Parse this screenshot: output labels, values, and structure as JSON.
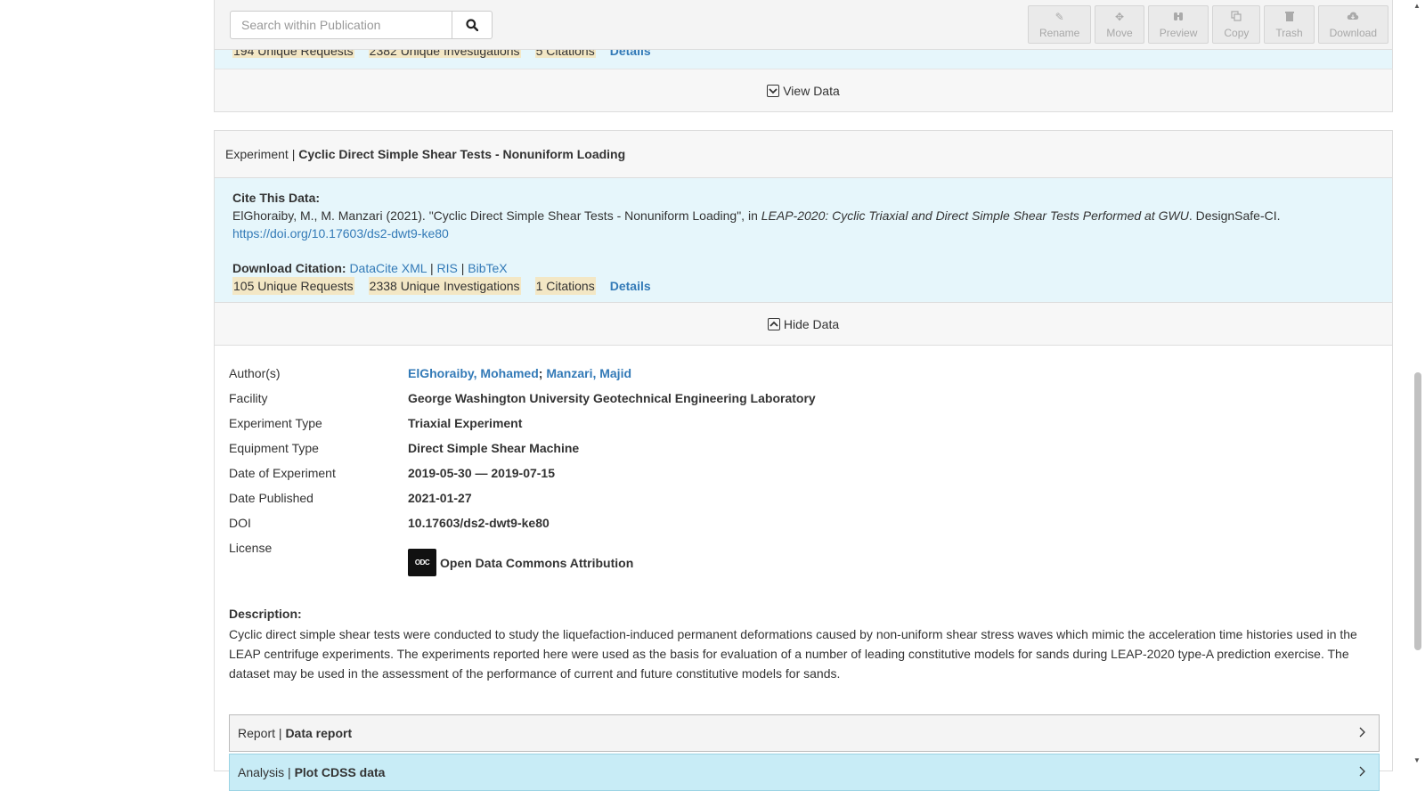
{
  "toolbar": {
    "search_placeholder": "Search within Publication",
    "buttons": [
      {
        "label": "Rename",
        "icon": "pencil-icon"
      },
      {
        "label": "Move",
        "icon": "move-icon"
      },
      {
        "label": "Preview",
        "icon": "binoculars-icon"
      },
      {
        "label": "Copy",
        "icon": "copy-icon"
      },
      {
        "label": "Trash",
        "icon": "trash-icon"
      },
      {
        "label": "Download",
        "icon": "cloud-download-icon"
      }
    ]
  },
  "card1": {
    "metrics": {
      "requests": "194 Unique Requests",
      "investigations": "2382 Unique Investigations",
      "citations": "5 Citations",
      "details": "Details"
    },
    "toggle_label": "View Data"
  },
  "experiment": {
    "type_label": "Experiment |",
    "title": "Cyclic Direct Simple Shear Tests - Nonuniform Loading",
    "cite_title": "Cite This Data:",
    "citation_pre": "ElGhoraiby, M., M. Manzari (2021). \"Cyclic Direct Simple Shear Tests - Nonuniform Loading\", in ",
    "citation_italic": "LEAP-2020: Cyclic Triaxial and Direct Simple Shear Tests Performed at GWU",
    "citation_post": ". DesignSafe-CI.",
    "doi_url": "https://doi.org/10.17603/ds2-dwt9-ke80",
    "download_label": "Download Citation:",
    "download_links": [
      "DataCite XML",
      "RIS",
      "BibTeX"
    ],
    "separator": "|",
    "metrics": {
      "requests": "105 Unique Requests",
      "investigations": "2338 Unique Investigations",
      "citations": "1 Citations",
      "details": "Details"
    },
    "toggle_label": "Hide Data",
    "fields": {
      "authors_label": "Author(s)",
      "authors": [
        "ElGhoraiby, Mohamed",
        "Manzari, Majid"
      ],
      "author_sep": ";",
      "facility_label": "Facility",
      "facility": "George Washington University Geotechnical Engineering Laboratory",
      "exp_type_label": "Experiment Type",
      "exp_type": "Triaxial Experiment",
      "equip_label": "Equipment Type",
      "equip": "Direct Simple Shear Machine",
      "date_exp_label": "Date of Experiment",
      "date_exp": "2019-05-30 — 2019-07-15",
      "date_pub_label": "Date Published",
      "date_pub": "2021-01-27",
      "doi_label": "DOI",
      "doi": "10.17603/ds2-dwt9-ke80",
      "license_label": "License",
      "license_icon_text": "ODC",
      "license": "Open Data Commons Attribution"
    },
    "description_title": "Description:",
    "description": "Cyclic direct simple shear tests were conducted to study the liquefaction-induced permanent deformations caused by non-uniform shear stress waves which mimic the acceleration time histories used in the LEAP centrifuge experiments. The experiments reported here were used as the basis for evaluation of a number of leading constitutive models for sands during LEAP-2020 type-A prediction exercise. The dataset may be used in the assessment of the performance of current and future constitutive models for sands.",
    "report": {
      "type_label": "Report |",
      "title": "Data report"
    },
    "analysis": {
      "type_label": "Analysis |",
      "title": "Plot CDSS data"
    }
  }
}
